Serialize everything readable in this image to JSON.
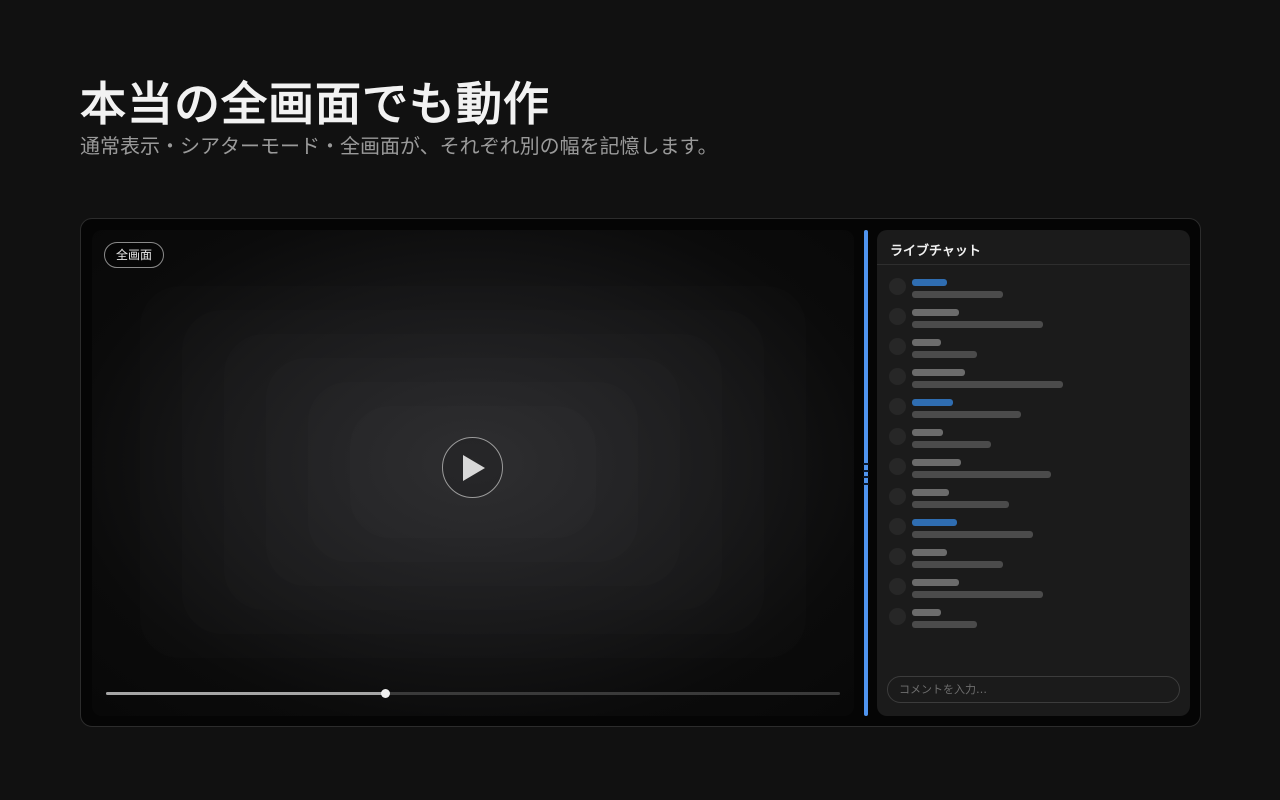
{
  "hero": {
    "title": "本当の全画面でも動作",
    "subtitle": "通常表示・シアターモード・全画面が、それぞれ別の幅を記憶します。"
  },
  "player": {
    "mode_badge": "全画面",
    "play_icon": "play-icon",
    "progress_fraction": 0.38
  },
  "chat": {
    "title": "ライブチャット",
    "input_placeholder": "コメントを入力…",
    "messages": [
      {
        "highlight": true,
        "name_len": 35,
        "text_len": 91
      },
      {
        "highlight": false,
        "name_len": 47,
        "text_len": 131
      },
      {
        "highlight": false,
        "name_len": 29,
        "text_len": 65
      },
      {
        "highlight": false,
        "name_len": 53,
        "text_len": 151
      },
      {
        "highlight": true,
        "name_len": 41,
        "text_len": 109
      },
      {
        "highlight": false,
        "name_len": 31,
        "text_len": 79
      },
      {
        "highlight": false,
        "name_len": 49,
        "text_len": 139
      },
      {
        "highlight": false,
        "name_len": 37,
        "text_len": 97
      },
      {
        "highlight": true,
        "name_len": 45,
        "text_len": 121
      },
      {
        "highlight": false,
        "name_len": 35,
        "text_len": 91
      },
      {
        "highlight": false,
        "name_len": 47,
        "text_len": 131
      },
      {
        "highlight": false,
        "name_len": 29,
        "text_len": 65
      }
    ]
  },
  "colors": {
    "accent": "#4f94ef",
    "highlight_name": "#2f6db1",
    "plain_name": "#6c6c6c"
  }
}
